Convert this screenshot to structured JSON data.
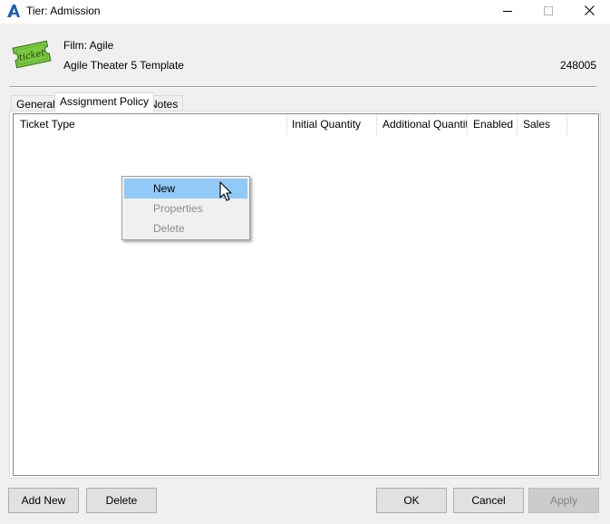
{
  "window": {
    "title": "Tier: Admission"
  },
  "header": {
    "icon_text": "ticket",
    "film": "Film: Agile",
    "template": "Agile Theater 5 Template",
    "id": "248005"
  },
  "tabs": [
    {
      "label": "General"
    },
    {
      "label": "Assignment Policy"
    },
    {
      "label": "Notes"
    }
  ],
  "table": {
    "columns": [
      {
        "label": "Ticket Type"
      },
      {
        "label": "Initial Quantity"
      },
      {
        "label": "Additional Quantity"
      },
      {
        "label": "Enabled"
      },
      {
        "label": "Sales"
      }
    ],
    "rows": []
  },
  "context_menu": {
    "items": [
      {
        "label": "New",
        "enabled": true,
        "highlighted": true
      },
      {
        "label": "Properties",
        "enabled": false
      },
      {
        "label": "Delete",
        "enabled": false
      }
    ]
  },
  "buttons": {
    "add_new": "Add New",
    "delete": "Delete",
    "ok": "OK",
    "cancel": "Cancel",
    "apply": "Apply"
  },
  "colors": {
    "accent": "#1a5fb4",
    "menu_highlight": "#91c9f7",
    "ticket_green": "#7ac943"
  }
}
